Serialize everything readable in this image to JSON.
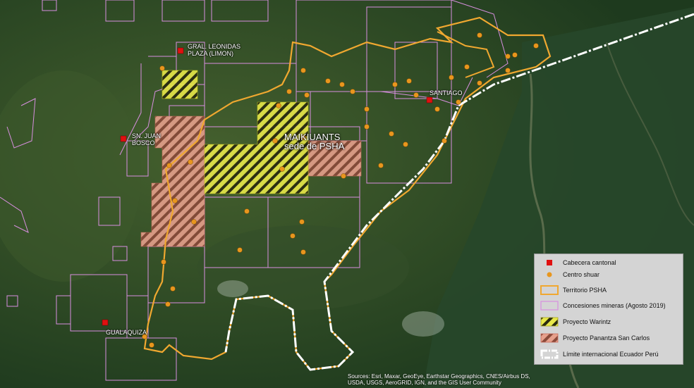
{
  "places": {
    "limon": "GRAL. LEONIDAS\nPLAZA (LIMON)",
    "san_juan_bosco": "SN. JUAN\nBOSCO",
    "santiago": "SANTIAGO",
    "gualaquiza": "GUALAQUIZA",
    "maikiuants": "MAIKIUANTS",
    "maikiuants_sub": "sede de PSHA"
  },
  "legend": {
    "items": [
      {
        "label": "Cabecera cantonal",
        "icon": "red-square"
      },
      {
        "label": "Centro shuar",
        "icon": "orange-circle"
      },
      {
        "label": "Territorio PSHA",
        "icon": "orange-outline"
      },
      {
        "label": "Concesiones mineras (Agosto 2019)",
        "icon": "pink-outline"
      },
      {
        "label": "Proyecto Warintz",
        "icon": "yellow-hatch"
      },
      {
        "label": "Proyecto Panantza San Carlos",
        "icon": "salmon-hatch"
      },
      {
        "label": "Límite internacional Ecuador Perú",
        "icon": "white-dash"
      }
    ]
  },
  "credits": "Sources: Esri, Maxar, GeoEye, Earthstar Geographics, CNES/Airbus DS, USDA, USGS, AeroGRID, IGN, and the GIS User Community",
  "colors": {
    "territory": "#f0a830",
    "concession": "#d88fe0",
    "warintz": "#e8e84a",
    "panantza": "#e39a86",
    "cabecera": "#e01010",
    "centro": "#e8961e",
    "border": "#ffffff"
  }
}
